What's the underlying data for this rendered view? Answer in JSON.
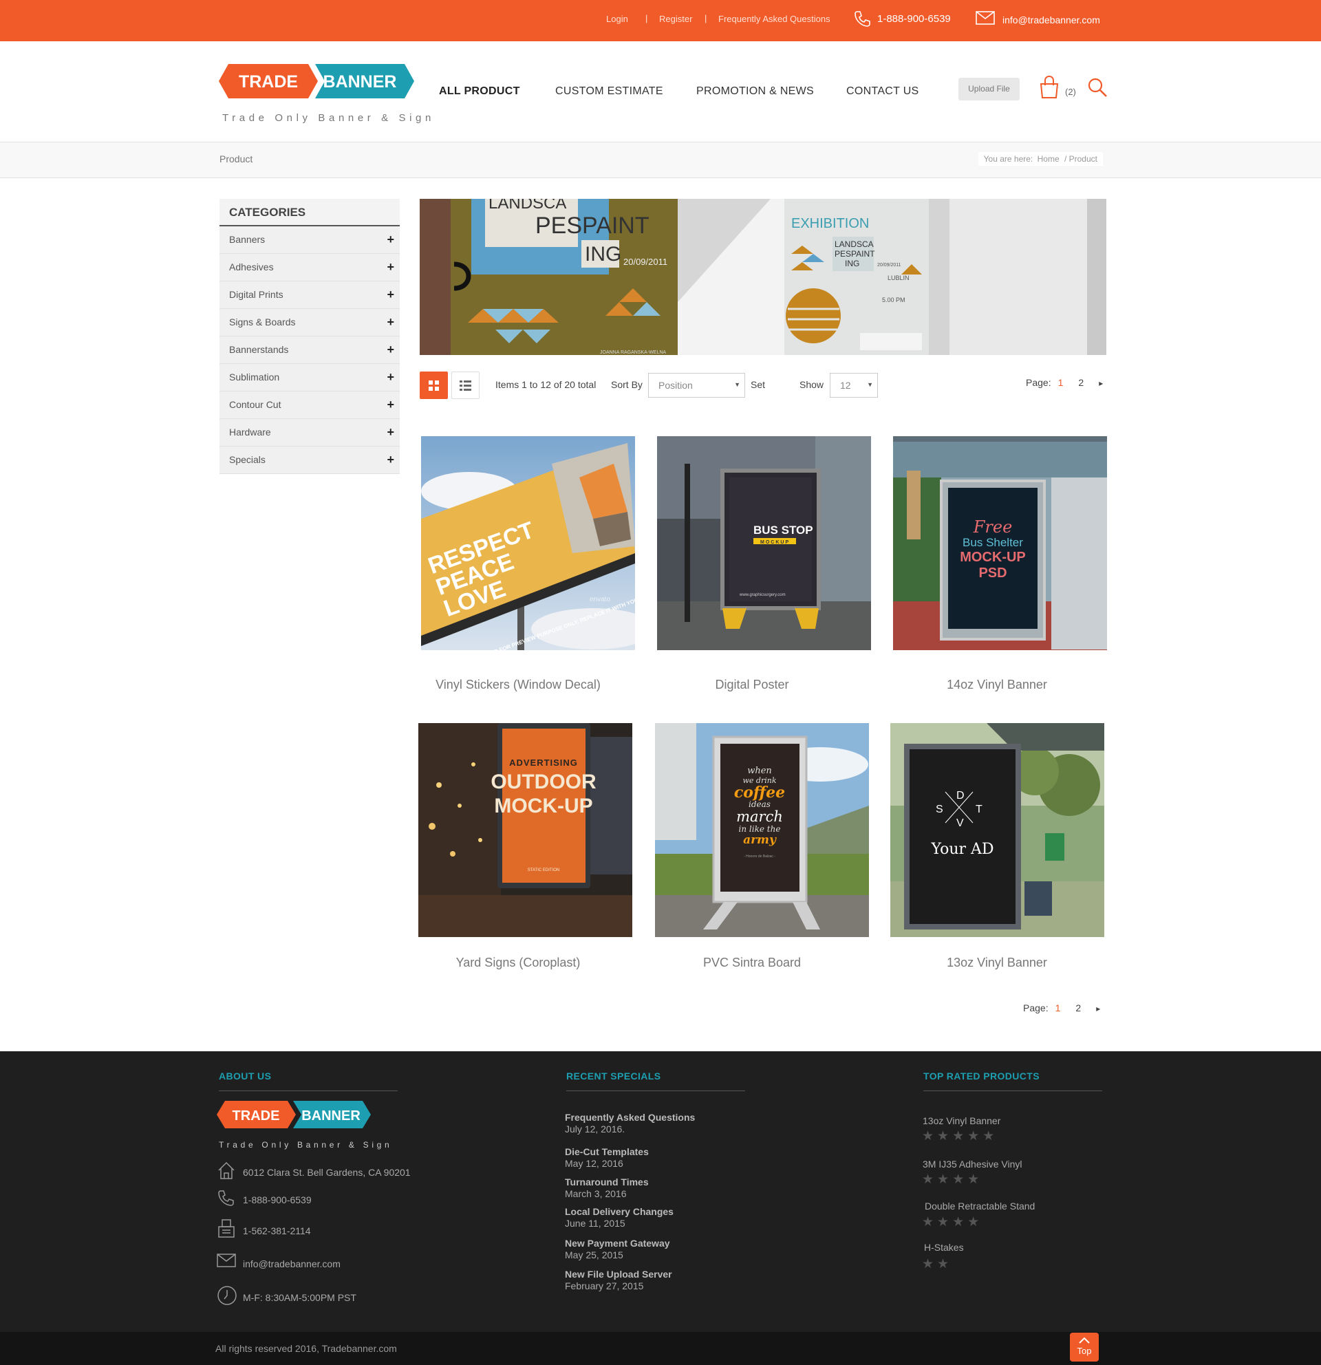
{
  "topbar": {
    "login": "Login",
    "register": "Register",
    "faq": "Frequently Asked Questions",
    "separator": "|",
    "phone": "1-888-900-6539",
    "email": "info@tradebanner.com"
  },
  "logo": {
    "word1": "TRADE",
    "word2": "BANNER",
    "tagline": "Trade Only Banner & Sign"
  },
  "nav": {
    "items": [
      {
        "label": "ALL PRODUCT",
        "active": true
      },
      {
        "label": "CUSTOM ESTIMATE",
        "active": false
      },
      {
        "label": "PROMOTION & NEWS",
        "active": false
      },
      {
        "label": "CONTACT US",
        "active": false
      }
    ],
    "upload_label": "Upload File",
    "cart_count": "(2)"
  },
  "breadcrumb": {
    "title": "Product",
    "prefix": "You are here:",
    "home": "Home",
    "current": "/ Product"
  },
  "sidebar": {
    "heading": "CATEGORIES",
    "items": [
      {
        "label": "Banners",
        "icon": "+"
      },
      {
        "label": "Adhesives",
        "icon": "+"
      },
      {
        "label": "Digital Prints",
        "icon": "+"
      },
      {
        "label": "Signs & Boards",
        "icon": "+"
      },
      {
        "label": "Bannerstands",
        "icon": "+"
      },
      {
        "label": "Sublimation",
        "icon": "+"
      },
      {
        "label": "Contour Cut",
        "icon": "+"
      },
      {
        "label": "Hardware",
        "icon": "+"
      },
      {
        "label": "Specials",
        "icon": "+"
      }
    ]
  },
  "hero": {
    "poster_big_line1": "LANDSCA",
    "poster_big_line2": "PESPAINT",
    "poster_big_line3": "ING",
    "poster_big_date": "20/09/2011",
    "poster_big_credit": "JOANNA RAGANSKA-WELNA",
    "poster_small_head": "EXHIBITION",
    "poster_small_line1": "LANDSCA",
    "poster_small_line2": "PESPAINT",
    "poster_small_line3": "ING",
    "poster_small_date": "20/09/2011",
    "poster_small_city": "LUBLIN",
    "poster_small_time": "5.00 PM"
  },
  "toolbar": {
    "items_text": "Items 1 to 12 of 20 total",
    "sort_label": "Sort By",
    "sort_value": "Position",
    "set_label": "Set",
    "show_label": "Show",
    "show_value": "12",
    "page_label": "Page:",
    "pages": [
      "1",
      "2"
    ],
    "current_page": "1",
    "next_symbol": "▸"
  },
  "products": [
    {
      "name": "Vinyl Stickers (Window Decal)",
      "art_line1": "RESPECT",
      "art_line2": "PEACE",
      "art_line3": "LOVE",
      "art_strip": "THIS IS EXAMPLE AD FOR PREVIEW PURPOSE ONLY. REPLACE IT WITH YOURS",
      "art_watermark": "envato"
    },
    {
      "name": "Digital Poster",
      "art_line1": "BUS STOP",
      "art_line2": "MOCKUP",
      "art_line3": "www.graphicsurgery.com"
    },
    {
      "name": "14oz Vinyl Banner",
      "art_line1": "Free",
      "art_line2": "Bus Shelter",
      "art_line3": "MOCK-UP",
      "art_line4": "PSD"
    },
    {
      "name": "Yard Signs (Coroplast)",
      "art_line1": "ADVERTISING",
      "art_line2": "OUTDOOR",
      "art_line3": "MOCK-UP",
      "art_line4": "STATIC EDITION"
    },
    {
      "name": "PVC Sintra Board",
      "art_line1": "when",
      "art_line2": "we drink",
      "art_line3": "coffee",
      "art_line4": "ideas",
      "art_line5": "march",
      "art_line6": "in like the",
      "art_line7": "army",
      "art_line8": "- Honore de Balzac -"
    },
    {
      "name": "13oz Vinyl Banner",
      "art_d": "D",
      "art_s": "S",
      "art_t": "T",
      "art_v": "V",
      "art_line1": "Your AD"
    }
  ],
  "footer": {
    "about_heading": "ABOUT US",
    "specials_heading": "RECENT SPECIALS",
    "rated_heading": "TOP RATED PRODUCTS",
    "address": "6012 Clara St. Bell Gardens, CA 90201",
    "phone": "1-888-900-6539",
    "fax": "1-562-381-2114",
    "email": "info@tradebanner.com",
    "hours": "M-F: 8:30AM-5:00PM PST",
    "specials": [
      {
        "title": "Frequently Asked Questions",
        "date": "July 12, 2016."
      },
      {
        "title": "Die-Cut Templates",
        "date": "May 12, 2016"
      },
      {
        "title": "Turnaround Times",
        "date": "March 3, 2016"
      },
      {
        "title": "Local Delivery Changes",
        "date": "June 11, 2015"
      },
      {
        "title": "New Payment Gateway",
        "date": "May 25, 2015"
      },
      {
        "title": "New File Upload Server",
        "date": "February 27, 2015"
      }
    ],
    "rated": [
      {
        "name": "13oz Vinyl Banner",
        "stars": 5
      },
      {
        "name": "3M IJ35 Adhesive Vinyl",
        "stars": 4
      },
      {
        "name": "Double Retractable Stand",
        "stars": 4
      },
      {
        "name": "H-Stakes",
        "stars": 2
      }
    ],
    "copyright": "All rights reserved 2016, Tradebanner.com",
    "top_label": "Top"
  },
  "colors": {
    "brand_orange": "#f15a29",
    "brand_teal": "#1d9fb1",
    "footer_bg": "#1f1f1f"
  },
  "icons": [
    "phone-icon",
    "mail-icon",
    "cart-icon",
    "search-icon",
    "grid-view-icon",
    "list-view-icon",
    "home-icon",
    "fax-icon",
    "clock-icon",
    "chevron-up-icon",
    "star-icon"
  ]
}
